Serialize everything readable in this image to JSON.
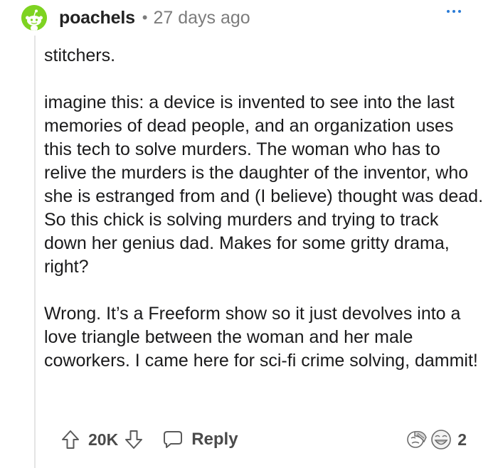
{
  "comment": {
    "username": "poachels",
    "separator": "•",
    "timestamp": "27 days ago",
    "paragraphs": [
      "stitchers.",
      "imagine this: a device is invented to see into the last memories of dead people, and an organization uses this tech to solve murders. The woman who has to relive the murders is the daughter of the inventor, who she is estranged from and (I believe) thought was dead. So this chick is solving murders and trying to track down her genius dad. Makes for some gritty drama, right?",
      "Wrong. It’s a Freeform show so it just devolves into a love triangle between the woman and her male coworkers. I came here for sci-fi crime solving, dammit!"
    ],
    "score": "20K",
    "reply_label": "Reply",
    "award_count": "2"
  },
  "icons": {
    "avatar": "snoo-avatar-icon",
    "more": "more-options-icon",
    "upvote": "upvote-arrow-icon",
    "downvote": "downvote-arrow-icon",
    "reply": "reply-bubble-icon",
    "award1": "facepalm-award-icon",
    "award2": "laughing-face-award-icon"
  },
  "colors": {
    "avatar_bg": "#7ed321",
    "more_dots": "#2a7bd6",
    "muted_text": "#7c7c7c",
    "action_text": "#4a4a4a"
  }
}
